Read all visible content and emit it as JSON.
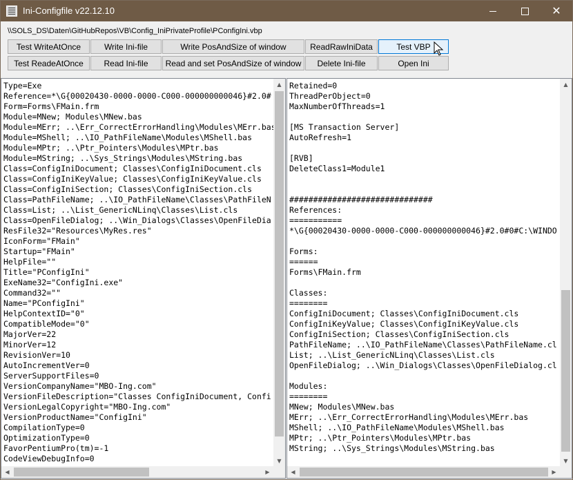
{
  "window": {
    "title": "Ini-Configfile v22.12.10",
    "icons": {
      "app": "ini-file-icon",
      "minimize": "minimize-icon",
      "maximize": "maximize-icon",
      "close": "close-icon"
    }
  },
  "path_label": "\\\\SOLS_DS\\Daten\\GitHubRepos\\VB\\Config_IniPrivateProfile\\PConfigIni.vbp",
  "buttons": {
    "row1": [
      "Test WriteAtOnce",
      "Write Ini-file",
      "Write PosAndSize of window",
      "ReadRawIniData",
      "Test VBP"
    ],
    "row2": [
      "Test ReadeAtOnce",
      "Read Ini-file",
      "Read and set PosAndSize of window",
      "Delete Ini-file",
      "Open Ini"
    ]
  },
  "left_text": "Type=Exe\nReference=*\\G{00020430-0000-0000-C000-000000000046}#2.0#\nForm=Forms\\FMain.frm\nModule=MNew; Modules\\MNew.bas\nModule=MErr; ..\\Err_CorrectErrorHandling\\Modules\\MErr.bas\nModule=MShell; ..\\IO_PathFileName\\Modules\\MShell.bas\nModule=MPtr; ..\\Ptr_Pointers\\Modules\\MPtr.bas\nModule=MString; ..\\Sys_Strings\\Modules\\MString.bas\nClass=ConfigIniDocument; Classes\\ConfigIniDocument.cls\nClass=ConfigIniKeyValue; Classes\\ConfigIniKeyValue.cls\nClass=ConfigIniSection; Classes\\ConfigIniSection.cls\nClass=PathFileName; ..\\IO_PathFileName\\Classes\\PathFileN\nClass=List; ..\\List_GenericNLinq\\Classes\\List.cls\nClass=OpenFileDialog; ..\\Win_Dialogs\\Classes\\OpenFileDia\nResFile32=\"Resources\\MyRes.res\"\nIconForm=\"FMain\"\nStartup=\"FMain\"\nHelpFile=\"\"\nTitle=\"PConfigIni\"\nExeName32=\"ConfigIni.exe\"\nCommand32=\"\"\nName=\"PConfigIni\"\nHelpContextID=\"0\"\nCompatibleMode=\"0\"\nMajorVer=22\nMinorVer=12\nRevisionVer=10\nAutoIncrementVer=0\nServerSupportFiles=0\nVersionCompanyName=\"MBO-Ing.com\"\nVersionFileDescription=\"Classes ConfigIniDocument, Confi\nVersionLegalCopyright=\"MBO-Ing.com\"\nVersionProductName=\"ConfigIni\"\nCompilationType=0\nOptimizationType=0\nFavorPentiumPro(tm)=-1\nCodeViewDebugInfo=0",
  "right_text": "Retained=0\nThreadPerObject=0\nMaxNumberOfThreads=1\n\n[MS Transaction Server]\nAutoRefresh=1\n\n[RVB]\nDeleteClass1=Module1\n\n\n##############################\nReferences:\n===========\n*\\G{00020430-0000-0000-C000-000000000046}#2.0#0#C:\\WINDO\n\nForms:\n======\nForms\\FMain.frm\n\nClasses:\n========\nConfigIniDocument; Classes\\ConfigIniDocument.cls\nConfigIniKeyValue; Classes\\ConfigIniKeyValue.cls\nConfigIniSection; Classes\\ConfigIniSection.cls\nPathFileName; ..\\IO_PathFileName\\Classes\\PathFileName.cl\nList; ..\\List_GenericNLinq\\Classes\\List.cls\nOpenFileDialog; ..\\Win_Dialogs\\Classes\\OpenFileDialog.cl\n\nModules:\n========\nMNew; Modules\\MNew.bas\nMErr; ..\\Err_CorrectErrorHandling\\Modules\\MErr.bas\nMShell; ..\\IO_PathFileName\\Modules\\MShell.bas\nMPtr; ..\\Ptr_Pointers\\Modules\\MPtr.bas\nMString; ..\\Sys_Strings\\Modules\\MString.bas",
  "scroll_icons": {
    "up": "scroll-up-arrow-icon",
    "down": "scroll-down-arrow-icon",
    "left": "scroll-left-arrow-icon",
    "right": "scroll-right-arrow-icon"
  },
  "colors": {
    "titlebar": "#6f5b46",
    "button_face": "#e1e1e1",
    "focus_border": "#0078d7"
  }
}
